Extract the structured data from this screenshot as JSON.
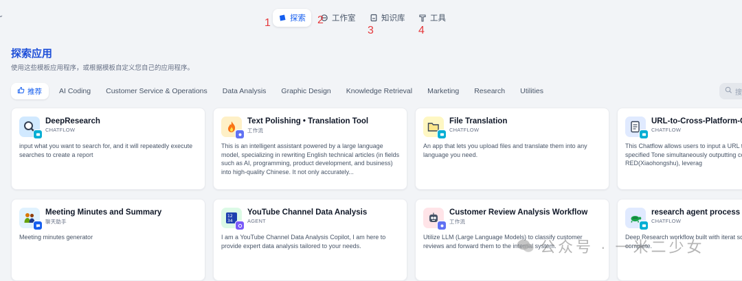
{
  "nav": {
    "explore": "探索",
    "studio": "工作室",
    "knowledge": "知识库",
    "tools": "工具"
  },
  "annotations": [
    "1",
    "2",
    "3",
    "4"
  ],
  "page": {
    "title": "探索应用",
    "subtitle": "使用这些模板应用程序，或根据模板自定义您自己的应用程序。"
  },
  "categories": [
    "推荐",
    "AI Coding",
    "Customer Service & Operations",
    "Data Analysis",
    "Graphic Design",
    "Knowledge Retrieval",
    "Marketing",
    "Research",
    "Utilities"
  ],
  "search": {
    "placeholder": "搜索"
  },
  "apps": [
    {
      "name": "DeepResearch",
      "type": "CHATFLOW",
      "desc": "input what you want to search for, and it will repeatedly execute searches to create a report",
      "icon": "magnifier-icon",
      "bg": "#d1e9ff"
    },
    {
      "name": "Text Polishing • Translation Tool",
      "type": "工作流",
      "desc": "This is an intelligent assistant powered by a large language model, specializing in rewriting English technical articles (in fields such as AI, programming, product development, and business) into high-quality Chinese. It not only accurately...",
      "icon": "fire-icon",
      "bg": "#fef0c7"
    },
    {
      "name": "File Translation",
      "type": "CHATFLOW",
      "desc": "An app that lets you upload files and translate them into any language you need.",
      "icon": "folder-icon",
      "bg": "#fef7c3"
    },
    {
      "name": "URL-to-Cross-Platform-Co",
      "type": "CHATFLOW",
      "desc": "This Chatflow allows users to input a URL text of the webpage into a specified Tone simultaneously outputting content for In Threads, and RED(Xiaohongshu), leverag",
      "icon": "document-icon",
      "bg": "#e0eaff"
    },
    {
      "name": "Meeting Minutes and Summary",
      "type": "聊天助手",
      "desc": "Meeting minutes generator",
      "icon": "people-icon",
      "bg": "#e0f2fe"
    },
    {
      "name": "YouTube Channel Data Analysis",
      "type": "AGENT",
      "desc": "I am a YouTube Channel Data Analysis Copilot, I am here to provide expert data analysis tailored to your needs.",
      "icon": "numbers-icon",
      "bg": "#dcfae6"
    },
    {
      "name": "Customer Review Analysis Workflow",
      "type": "工作流",
      "desc": "Utilize LLM (Large Language Models) to classify customer reviews and forward them to the internal system.",
      "icon": "robot-icon",
      "bg": "#ffe4e8"
    },
    {
      "name": "research agent process flo",
      "type": "CHATFLOW",
      "desc": "Deep Research workflow built with iterat sources until the answer is complete.",
      "icon": "turtle-icon",
      "bg": "#e0eaff"
    }
  ],
  "watermark": {
    "text": "公众号 · 一米二少女"
  },
  "colors": {
    "accent": "#155eef",
    "annotation_red": "#e5383b",
    "background": "#f2f4f7"
  }
}
